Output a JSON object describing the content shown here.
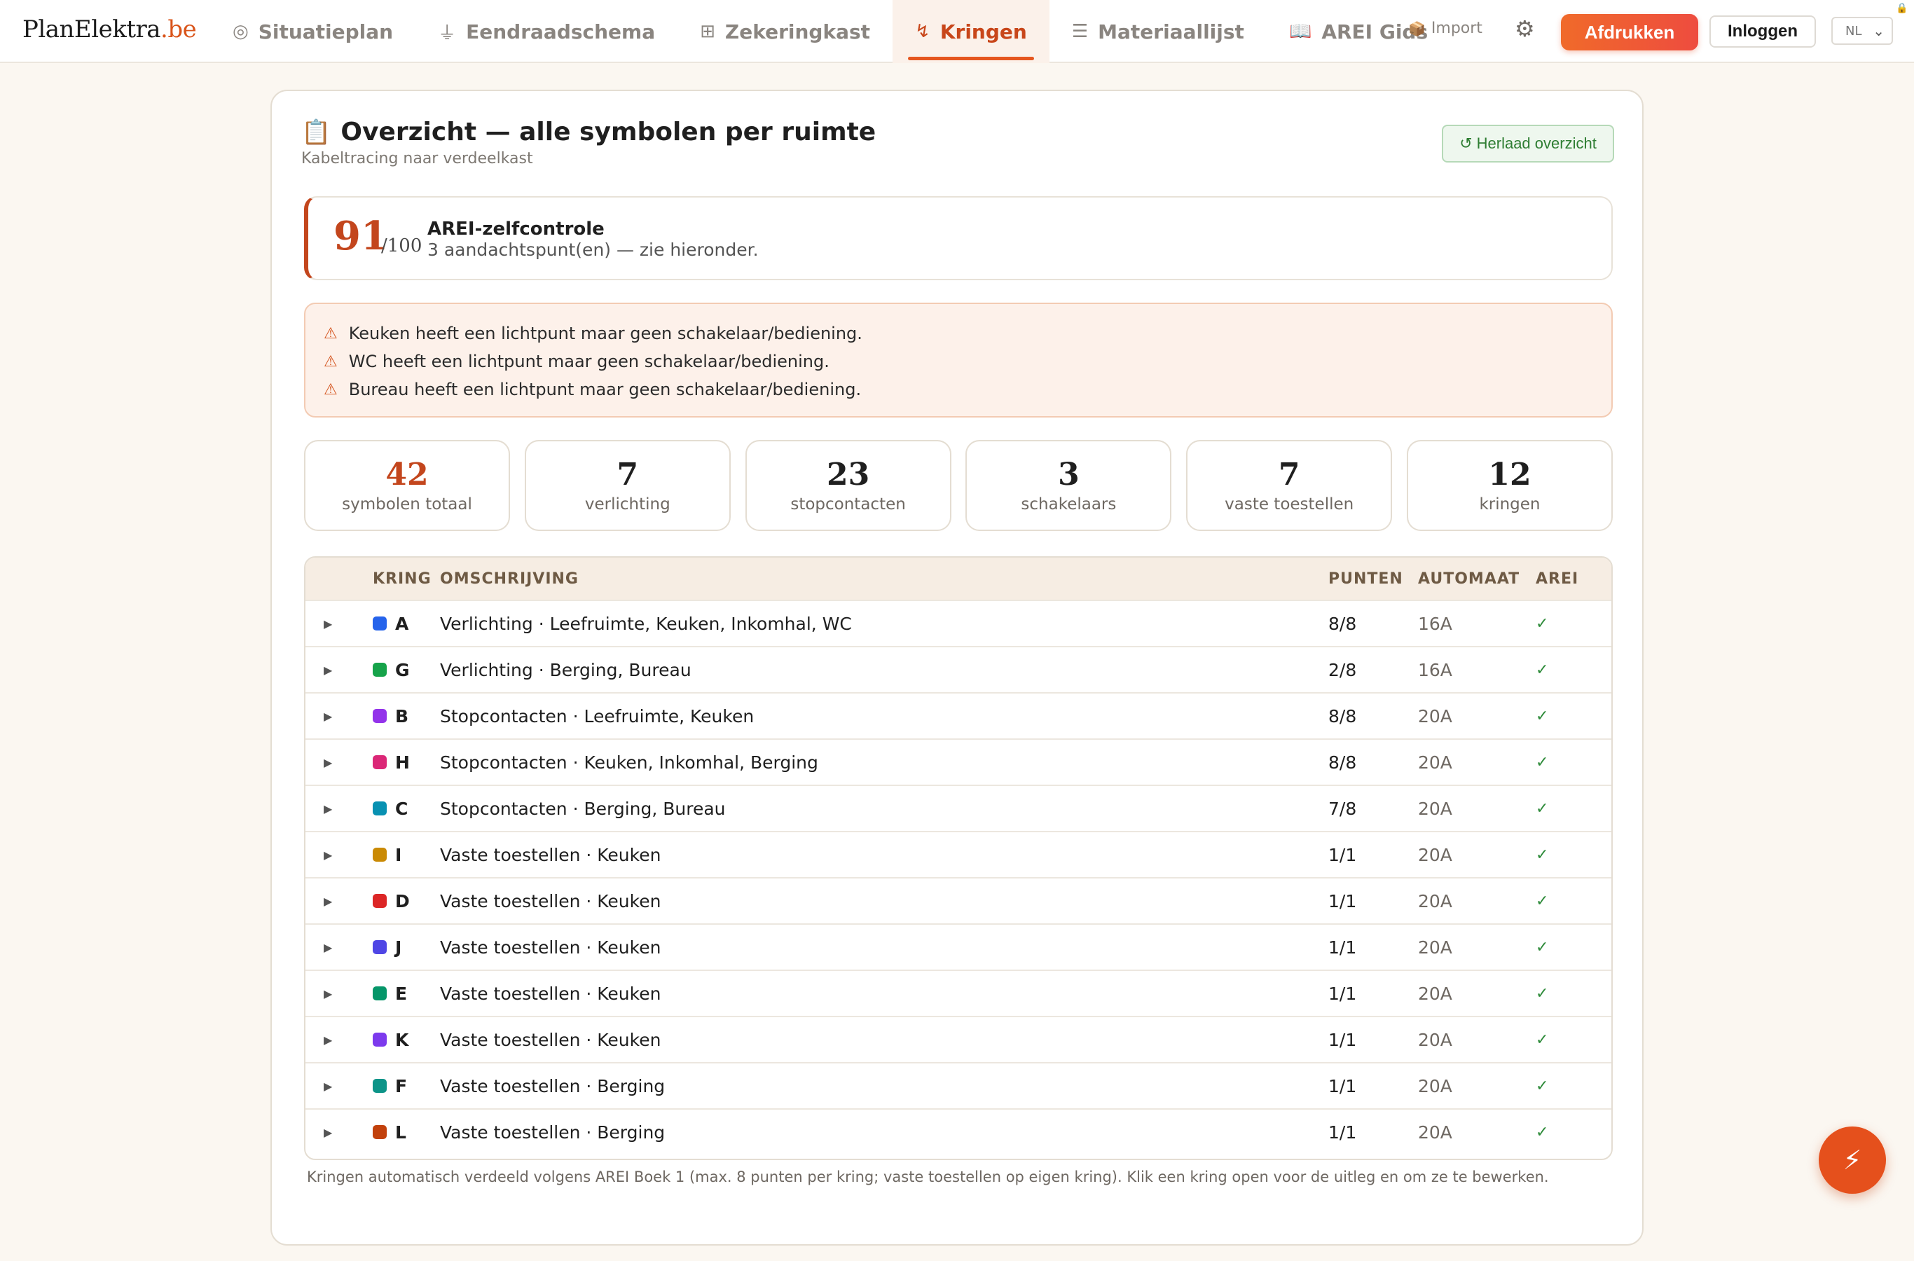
{
  "header": {
    "logo_main": "PlanElektra",
    "logo_tld": ".be",
    "nav": [
      {
        "icon": "◎",
        "label": "Situatieplan"
      },
      {
        "icon": "⏚",
        "label": "Eendraadschema"
      },
      {
        "icon": "⊞",
        "label": "Zekeringkast"
      },
      {
        "icon": "↯",
        "label": "Kringen"
      },
      {
        "icon": "☰",
        "label": "Materiaallijst"
      },
      {
        "icon": "📖",
        "label": "AREI Gids"
      }
    ],
    "active_nav": "Kringen",
    "import_icon": "📦",
    "import_label": "Import",
    "settings_icon": "⚙",
    "print_label": "Afdrukken",
    "login_label": "Inloggen",
    "language": "NL"
  },
  "overview": {
    "title_icon": "📋",
    "title": "Overzicht — alle symbolen per ruimte",
    "subtitle": "Kabeltracing naar verdeelkast",
    "reload_icon": "↺",
    "reload_label": "Herlaad overzicht"
  },
  "score": {
    "value": "91",
    "max": "/100",
    "title": "AREI-zelfcontrole",
    "text": "3 aandachtspunt(en) — zie hieronder."
  },
  "warnings": [
    "Keuken heeft een lichtpunt maar geen schakelaar/bediening.",
    "WC heeft een lichtpunt maar geen schakelaar/bediening.",
    "Bureau heeft een lichtpunt maar geen schakelaar/bediening."
  ],
  "stats": [
    {
      "value": "42",
      "label": "symbolen totaal"
    },
    {
      "value": "7",
      "label": "verlichting"
    },
    {
      "value": "23",
      "label": "stopcontacten"
    },
    {
      "value": "3",
      "label": "schakelaars"
    },
    {
      "value": "7",
      "label": "vaste toestellen"
    },
    {
      "value": "12",
      "label": "kringen"
    }
  ],
  "table": {
    "headers": {
      "kring": "KRING",
      "omschrijving": "OMSCHRIJVING",
      "punten": "PUNTEN",
      "automaat": "AUTOMAAT",
      "arei": "AREI"
    },
    "rows": [
      {
        "kring": "A",
        "color": "#2563eb",
        "desc": "Verlichting · Leefruimte, Keuken, Inkomhal, WC",
        "punten": "8/8",
        "automaat": "16A",
        "arei": "✓"
      },
      {
        "kring": "G",
        "color": "#16a34a",
        "desc": "Verlichting · Berging, Bureau",
        "punten": "2/8",
        "automaat": "16A",
        "arei": "✓"
      },
      {
        "kring": "B",
        "color": "#9333ea",
        "desc": "Stopcontacten · Leefruimte, Keuken",
        "punten": "8/8",
        "automaat": "20A",
        "arei": "✓"
      },
      {
        "kring": "H",
        "color": "#db2777",
        "desc": "Stopcontacten · Keuken, Inkomhal, Berging",
        "punten": "8/8",
        "automaat": "20A",
        "arei": "✓"
      },
      {
        "kring": "C",
        "color": "#0891b2",
        "desc": "Stopcontacten · Berging, Bureau",
        "punten": "7/8",
        "automaat": "20A",
        "arei": "✓"
      },
      {
        "kring": "I",
        "color": "#ca8a04",
        "desc": "Vaste toestellen · Keuken",
        "punten": "1/1",
        "automaat": "20A",
        "arei": "✓"
      },
      {
        "kring": "D",
        "color": "#dc2626",
        "desc": "Vaste toestellen · Keuken",
        "punten": "1/1",
        "automaat": "20A",
        "arei": "✓"
      },
      {
        "kring": "J",
        "color": "#4f46e5",
        "desc": "Vaste toestellen · Keuken",
        "punten": "1/1",
        "automaat": "20A",
        "arei": "✓"
      },
      {
        "kring": "E",
        "color": "#059669",
        "desc": "Vaste toestellen · Keuken",
        "punten": "1/1",
        "automaat": "20A",
        "arei": "✓"
      },
      {
        "kring": "K",
        "color": "#7c3aed",
        "desc": "Vaste toestellen · Keuken",
        "punten": "1/1",
        "automaat": "20A",
        "arei": "✓"
      },
      {
        "kring": "F",
        "color": "#0d9488",
        "desc": "Vaste toestellen · Berging",
        "punten": "1/1",
        "automaat": "20A",
        "arei": "✓"
      },
      {
        "kring": "L",
        "color": "#c2410c",
        "desc": "Vaste toestellen · Berging",
        "punten": "1/1",
        "automaat": "20A",
        "arei": "✓"
      }
    ]
  },
  "footnote": "Kringen automatisch verdeeld volgens AREI Boek 1 (max. 8 punten per kring; vaste toestellen op eigen kring). Klik een kring open voor de uitleg en om ze te bewerken.",
  "fab_icon": "⚡",
  "colors": {
    "accent": "#e5501c",
    "score": "#c3461d",
    "ok": "#2e8b3a"
  }
}
